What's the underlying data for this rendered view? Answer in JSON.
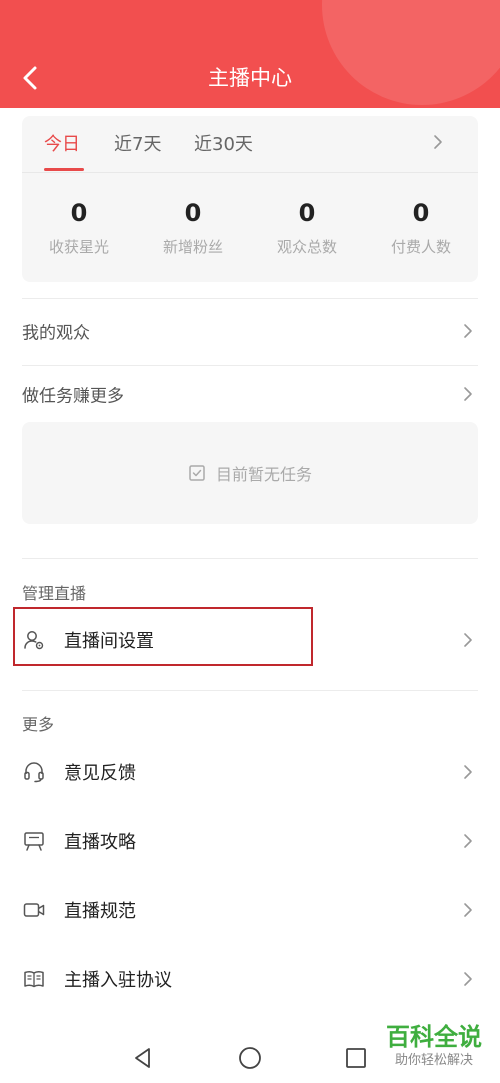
{
  "header": {
    "title": "主播中心"
  },
  "stats": {
    "tabs": [
      "今日",
      "近7天",
      "近30天"
    ],
    "items": [
      {
        "value": "0",
        "label": "收获星光"
      },
      {
        "value": "0",
        "label": "新增粉丝"
      },
      {
        "value": "0",
        "label": "观众总数"
      },
      {
        "value": "0",
        "label": "付费人数"
      }
    ]
  },
  "menu": {
    "audience": "我的观众",
    "tasks": "做任务赚更多",
    "empty_tasks": "目前暂无任务"
  },
  "manage": {
    "title": "管理直播",
    "room_settings": "直播间设置"
  },
  "more": {
    "title": "更多",
    "items": [
      {
        "label": "意见反馈",
        "icon": "headset-icon"
      },
      {
        "label": "直播攻略",
        "icon": "easel-icon"
      },
      {
        "label": "直播规范",
        "icon": "video-camera-icon"
      },
      {
        "label": "主播入驻协议",
        "icon": "book-icon"
      }
    ]
  },
  "watermark": {
    "title": "百科全说",
    "subtitle": "助你轻松解决"
  },
  "colors": {
    "brand": "#f24f4f",
    "accent": "#e84a4a",
    "highlight": "#c0282d",
    "watermark": "#3fae3f"
  }
}
